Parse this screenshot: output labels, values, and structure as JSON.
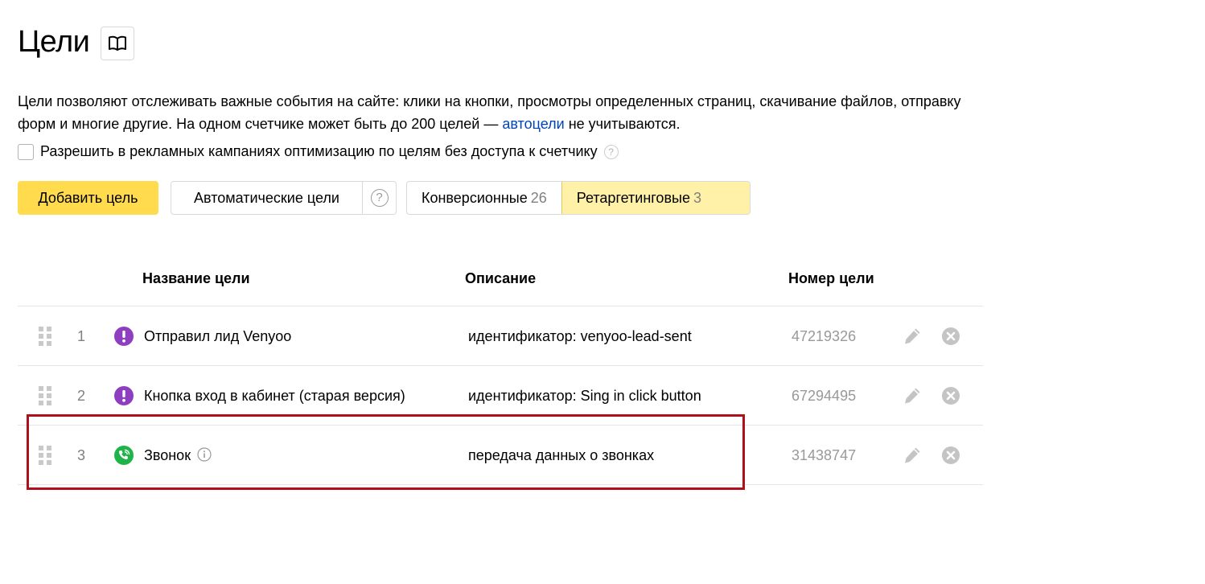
{
  "page": {
    "title": "Цели",
    "help_icon": "book-icon"
  },
  "intro": {
    "text_before_link": "Цели позволяют отслеживать важные события на сайте: клики на кнопки, просмотры определенных страниц, скачивание файлов, отправку форм и многие другие. На одном счетчике может быть до 200 целей — ",
    "link": "автоцели",
    "text_after_link": " не учитываются."
  },
  "allow": {
    "checked": false,
    "label": "Разрешить в рекламных кампаниях оптимизацию по целям без доступа к счетчику",
    "help": "?"
  },
  "toolbar": {
    "add_label": "Добавить цель",
    "auto_label": "Автоматические цели",
    "auto_help": "?",
    "tabs": [
      {
        "label": "Конверсионные",
        "count": "26",
        "active": false
      },
      {
        "label": "Ретаргетинговые",
        "count": "3",
        "active": true
      }
    ]
  },
  "table": {
    "headers": {
      "name": "Название цели",
      "description": "Описание",
      "id": "Номер цели"
    },
    "rows": [
      {
        "index": "1",
        "icon": "exclamation-icon",
        "icon_color": "#8e3fbf",
        "name": "Отправил лид Venyoo",
        "has_info": false,
        "description": "идентификатор: venyoo-lead-sent",
        "goal_id": "47219326"
      },
      {
        "index": "2",
        "icon": "exclamation-icon",
        "icon_color": "#8e3fbf",
        "name": "Кнопка вход в кабинет (старая версия)",
        "has_info": false,
        "description": "идентификатор: Sing in click button",
        "goal_id": "67294495"
      },
      {
        "index": "3",
        "icon": "phone-call-icon",
        "icon_color": "#1fb34a",
        "name": "Звонок",
        "has_info": true,
        "description": "передача данных о звонках",
        "goal_id": "31438747"
      }
    ]
  },
  "colors": {
    "accent": "#ffdb4d",
    "active_tab": "#fff1a8",
    "link": "#0044bb",
    "highlight_frame": "#b0101c"
  }
}
